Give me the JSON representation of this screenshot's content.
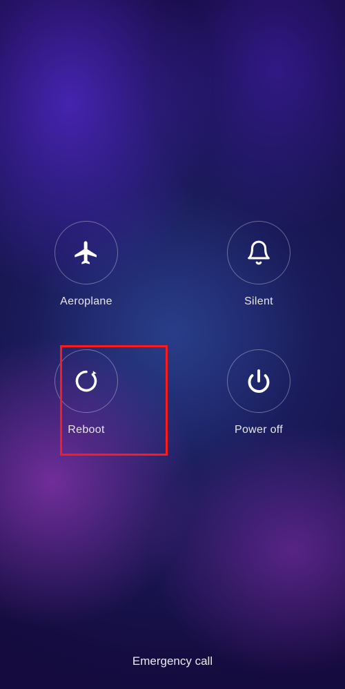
{
  "power_menu": {
    "items": [
      {
        "label": "Aeroplane"
      },
      {
        "label": "Silent"
      },
      {
        "label": "Reboot"
      },
      {
        "label": "Power off"
      }
    ]
  },
  "footer": {
    "emergency_label": "Emergency call"
  },
  "annotation": {
    "highlighted_item": "Reboot"
  }
}
